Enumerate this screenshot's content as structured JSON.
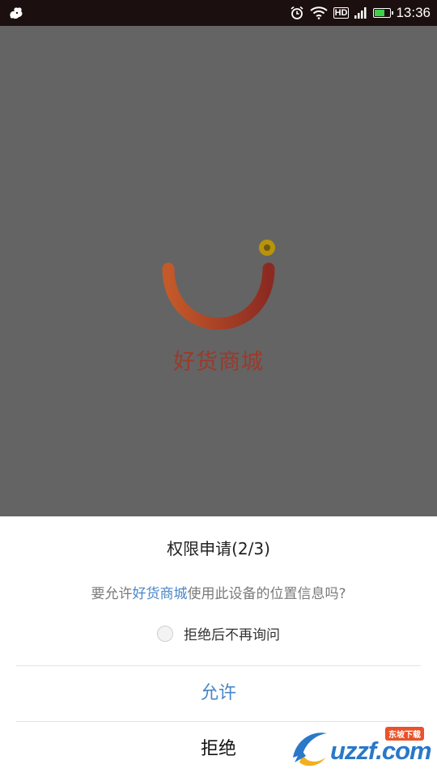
{
  "status_bar": {
    "time": "13:36",
    "network_label": "HD",
    "icons": [
      "squirrel-app-icon",
      "alarm-icon",
      "wifi-icon",
      "hd-icon",
      "signal-icon",
      "battery-icon"
    ],
    "battery_level": 0.6
  },
  "splash": {
    "brand_name": "好货商城",
    "logo_colors": {
      "arc_start": "#c45a2a",
      "arc_end": "#8c2a22",
      "dot": "#b8940a"
    }
  },
  "dialog": {
    "title": "权限申请(2/3)",
    "message_prefix": "要允许",
    "app_name": "好货商城",
    "message_suffix": "使用此设备的位置信息吗?",
    "checkbox_label": "拒绝后不再询问",
    "checkbox_checked": false,
    "allow_label": "允许",
    "deny_label": "拒绝"
  },
  "watermark": {
    "text": "uzzf.com",
    "badge": "东坡下载"
  },
  "colors": {
    "accent": "#4a86c8",
    "overlay": "#646464",
    "status_bar": "#1c0f0f"
  }
}
